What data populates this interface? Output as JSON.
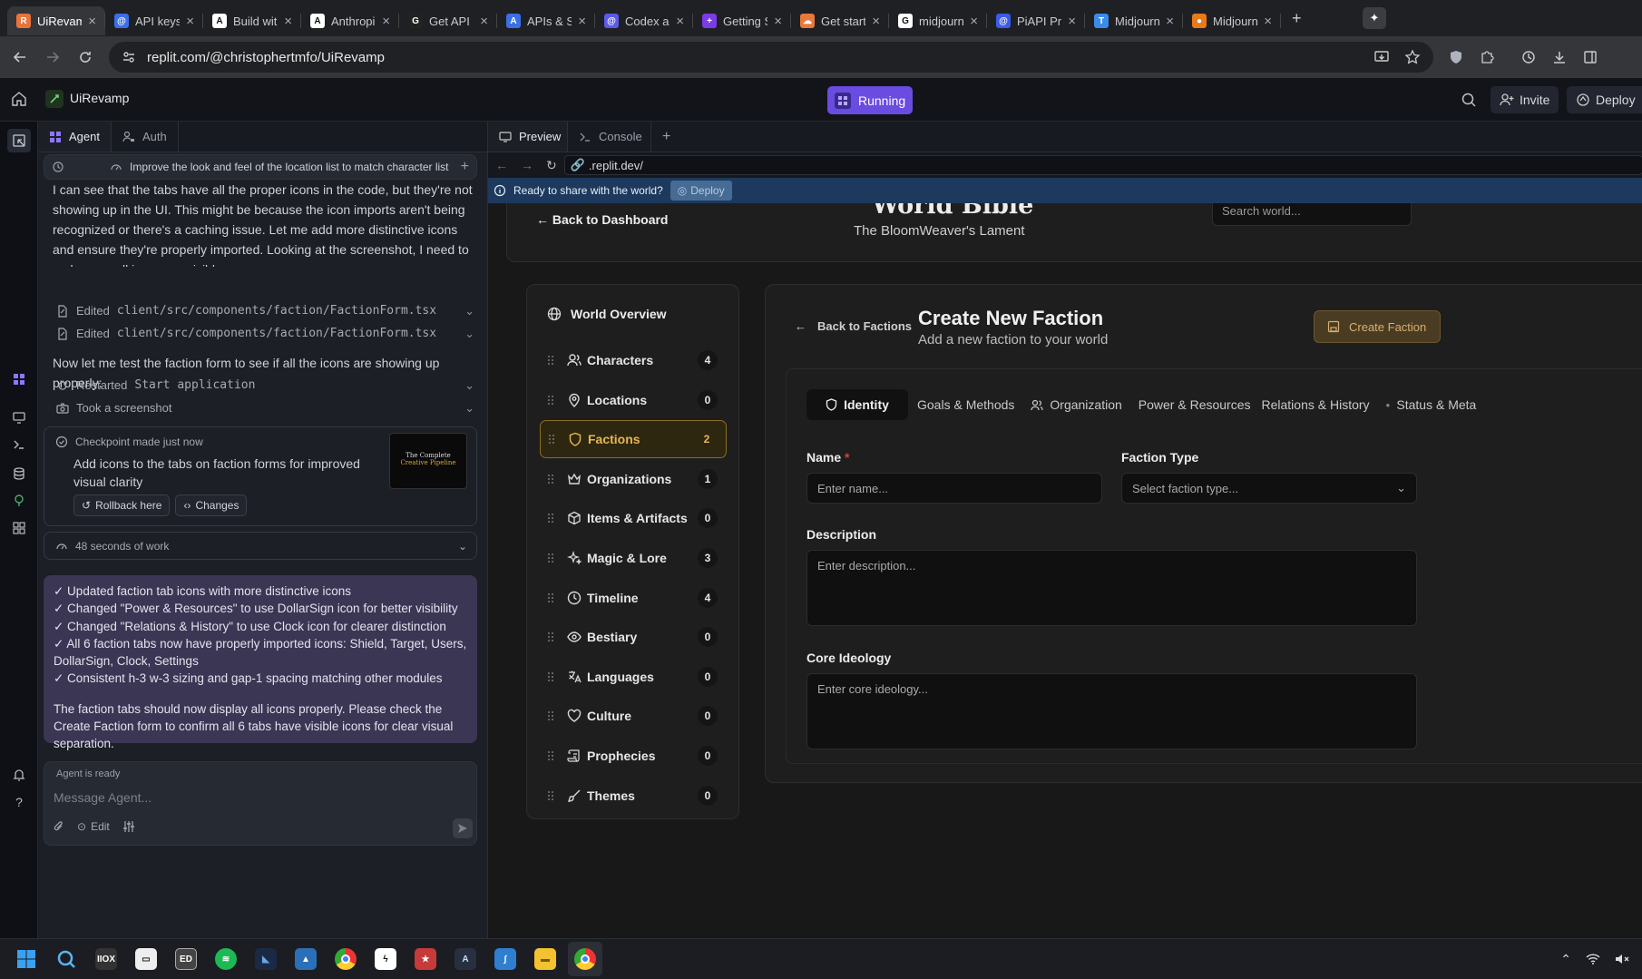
{
  "browser": {
    "tabs": [
      {
        "title": "UiRevamp",
        "color": "#e8743b",
        "glyph": "R"
      },
      {
        "title": "API keys -",
        "color": "#3b6fe8",
        "glyph": "@"
      },
      {
        "title": "Build with",
        "color": "#ffffff",
        "glyph": "A"
      },
      {
        "title": "Anthropic",
        "color": "#ffffff",
        "glyph": "A"
      },
      {
        "title": "Get API ke",
        "color": "#222222",
        "glyph": "G"
      },
      {
        "title": "APIs & Ser",
        "color": "#3b6fe8",
        "glyph": "A"
      },
      {
        "title": "Codex age",
        "color": "#5b5be8",
        "glyph": "@"
      },
      {
        "title": "Getting St",
        "color": "#7b3be8",
        "glyph": "+"
      },
      {
        "title": "Get starte",
        "color": "#e8783b",
        "glyph": "☁"
      },
      {
        "title": "midjourne",
        "color": "#ffffff",
        "glyph": "G"
      },
      {
        "title": "PiAPI Prici",
        "color": "#3b5be8",
        "glyph": "@"
      },
      {
        "title": "Midjourne",
        "color": "#3b8be8",
        "glyph": "T"
      },
      {
        "title": "Midjourne",
        "color": "#e87a1a",
        "glyph": "●"
      }
    ],
    "url": "replit.com/@christophertmfo/UiRevamp"
  },
  "replit": {
    "project_name": "UiRevamp",
    "run_status": "Running",
    "invite_label": "Invite",
    "deploy_label": "Deploy"
  },
  "agent_panel": {
    "tabs": [
      "Agent",
      "Auth"
    ],
    "current_task": "Improve the look and feel of the location list to match character list",
    "intro_text": "I can see that the tabs have all the proper icons in the code, but they're not showing up in the UI. This might be because the icon imports aren't being recognized or there's a caching issue. Let me add more distinctive icons and ensure they're properly imported. Looking at the screenshot, I need to make sure all icons are visible.",
    "edits": [
      {
        "verb": "Edited",
        "path": "client/src/components/faction/FactionForm.tsx"
      },
      {
        "verb": "Edited",
        "path": "client/src/components/faction/FactionForm.tsx"
      }
    ],
    "test_text": "Now let me test the faction form to see if all the icons are showing up properly:",
    "actions": [
      {
        "verb": "Restarted",
        "code": "Start application"
      },
      {
        "verb": "Took a screenshot",
        "code": ""
      }
    ],
    "checkpoint": {
      "title": "Checkpoint made just now",
      "desc": "Add icons to the tabs on faction forms for improved visual clarity",
      "rollback_label": "Rollback here",
      "changes_label": "Changes",
      "thumb_line1": "The Complete",
      "thumb_line2": "Creative Pipeline"
    },
    "work_time": "48 seconds of work",
    "summary_lines": [
      "✓ Updated faction tab icons with more distinctive icons",
      "✓ Changed \"Power & Resources\" to use DollarSign icon for better visibility",
      "✓ Changed \"Relations & History\" to use Clock icon for clearer distinction",
      "✓ All 6 faction tabs now have properly imported icons: Shield, Target, Users, DollarSign, Clock, Settings",
      "✓ Consistent h-3 w-3 sizing and gap-1 spacing matching other modules"
    ],
    "summary_footer": "The faction tabs should now display all icons properly. Please check the Create Faction form to confirm all 6 tabs have visible icons for clear visual separation.",
    "composer": {
      "status": "Agent is ready",
      "placeholder": "Message Agent...",
      "edit_label": "Edit"
    }
  },
  "preview_panel": {
    "tabs": [
      "Preview",
      "Console"
    ],
    "url": ".replit.dev/",
    "banner_text": "Ready to share with the world?",
    "banner_button": "Deploy"
  },
  "site": {
    "back_dashboard": "← Back to Dashboard",
    "title": "World Bible",
    "subtitle": "The BloomWeaver's Lament",
    "search_placeholder": "Search world...",
    "overview": "World Overview",
    "nav": [
      {
        "label": "Characters",
        "count": "4",
        "icon": "users-icon"
      },
      {
        "label": "Locations",
        "count": "0",
        "icon": "map-pin-icon"
      },
      {
        "label": "Factions",
        "count": "2",
        "icon": "shield-icon",
        "selected": true
      },
      {
        "label": "Organizations",
        "count": "1",
        "icon": "crown-icon"
      },
      {
        "label": "Items & Artifacts",
        "count": "0",
        "icon": "package-icon"
      },
      {
        "label": "Magic & Lore",
        "count": "3",
        "icon": "sparkles-icon"
      },
      {
        "label": "Timeline",
        "count": "4",
        "icon": "clock-icon"
      },
      {
        "label": "Bestiary",
        "count": "0",
        "icon": "eye-icon"
      },
      {
        "label": "Languages",
        "count": "0",
        "icon": "languages-icon"
      },
      {
        "label": "Culture",
        "count": "0",
        "icon": "heart-icon"
      },
      {
        "label": "Prophecies",
        "count": "0",
        "icon": "scroll-icon"
      },
      {
        "label": "Themes",
        "count": "0",
        "icon": "brush-icon"
      }
    ],
    "form": {
      "back_label": "Back to Factions",
      "title": "Create New Faction",
      "subtitle": "Add a new faction to your world",
      "create_button": "Create Faction",
      "tabs": [
        "Identity",
        "Goals & Methods",
        "Organization",
        "Power & Resources",
        "Relations & History",
        "Status & Meta"
      ],
      "name_label": "Name",
      "required_mark": "*",
      "name_placeholder": "Enter name...",
      "type_label": "Faction Type",
      "type_placeholder": "Select faction type...",
      "desc_label": "Description",
      "desc_placeholder": "Enter description...",
      "ideology_label": "Core Ideology",
      "ideology_placeholder": "Enter core ideology..."
    }
  },
  "colors": {
    "accent_gold": "#e5b754",
    "running_purple": "#6a4ce0",
    "summary_bg": "#3b3654"
  }
}
